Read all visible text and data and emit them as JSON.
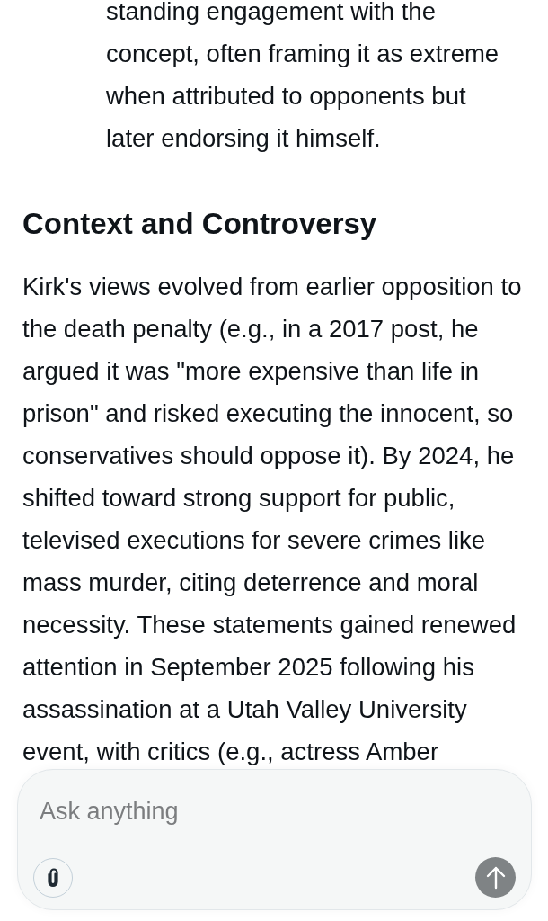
{
  "answer": {
    "list_item_lines": [
      "standing engagement with the",
      "concept, often framing it as extreme",
      "when attributed to opponents but",
      "later endorsing it himself."
    ],
    "heading": "Context and Controversy",
    "paragraph_lines": [
      "Kirk's views evolved from earlier opposition to",
      "the death penalty (e.g., in a 2017 post, he",
      "argued it was \"more expensive than life in",
      "prison\" and risked executing the innocent, so",
      "conservatives should oppose it). By 2024, he",
      "shifted toward strong support for public,",
      "televised executions for severe crimes like",
      "mass murder, citing deterrence and moral",
      "necessity. These statements gained renewed",
      "attention in September 2025 following his",
      "assassination at a Utah Valley University",
      "event, with critics (e.g., actress Amber"
    ]
  },
  "composer": {
    "placeholder": "Ask anything",
    "send_button": {
      "disabled": true
    }
  }
}
